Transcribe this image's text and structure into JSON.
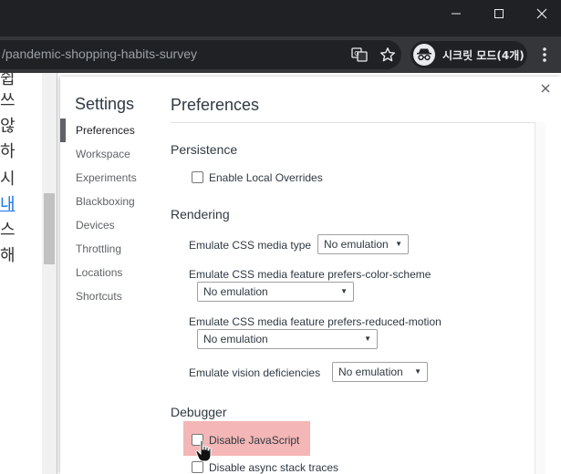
{
  "browser": {
    "url": "/pandemic-shopping-habits-survey",
    "profile_label": "시크릿 모드(4개)",
    "icons": {
      "minimize": "minimize-icon",
      "maximize": "maximize-icon",
      "close": "close-icon",
      "translate": "translate-icon",
      "bookmark": "star-icon",
      "incognito": "incognito-icon",
      "menu": "kebab-menu-icon"
    }
  },
  "page": {
    "chars": [
      "쉽",
      "쓰",
      "않",
      "하",
      "시",
      "내",
      "스",
      "해"
    ],
    "link_index": 5
  },
  "settings": {
    "title": "Settings",
    "nav": [
      "Preferences",
      "Workspace",
      "Experiments",
      "Blackboxing",
      "Devices",
      "Throttling",
      "Locations",
      "Shortcuts"
    ],
    "active": "Preferences"
  },
  "preferences": {
    "title": "Preferences",
    "persistence": {
      "heading": "Persistence",
      "enable_local_overrides": "Enable Local Overrides"
    },
    "rendering": {
      "heading": "Rendering",
      "media_type_label": "Emulate CSS media type",
      "media_type_value": "No emulation",
      "color_scheme_label": "Emulate CSS media feature prefers-color-scheme",
      "color_scheme_value": "No emulation",
      "reduced_motion_label": "Emulate CSS media feature prefers-reduced-motion",
      "reduced_motion_value": "No emulation",
      "vision_label": "Emulate vision deficiencies",
      "vision_value": "No emulation"
    },
    "debugger": {
      "heading": "Debugger",
      "disable_js": "Disable JavaScript",
      "disable_async": "Disable async stack traces"
    }
  },
  "colors": {
    "highlight": "#f4b6b6",
    "link": "#1a73e8"
  }
}
